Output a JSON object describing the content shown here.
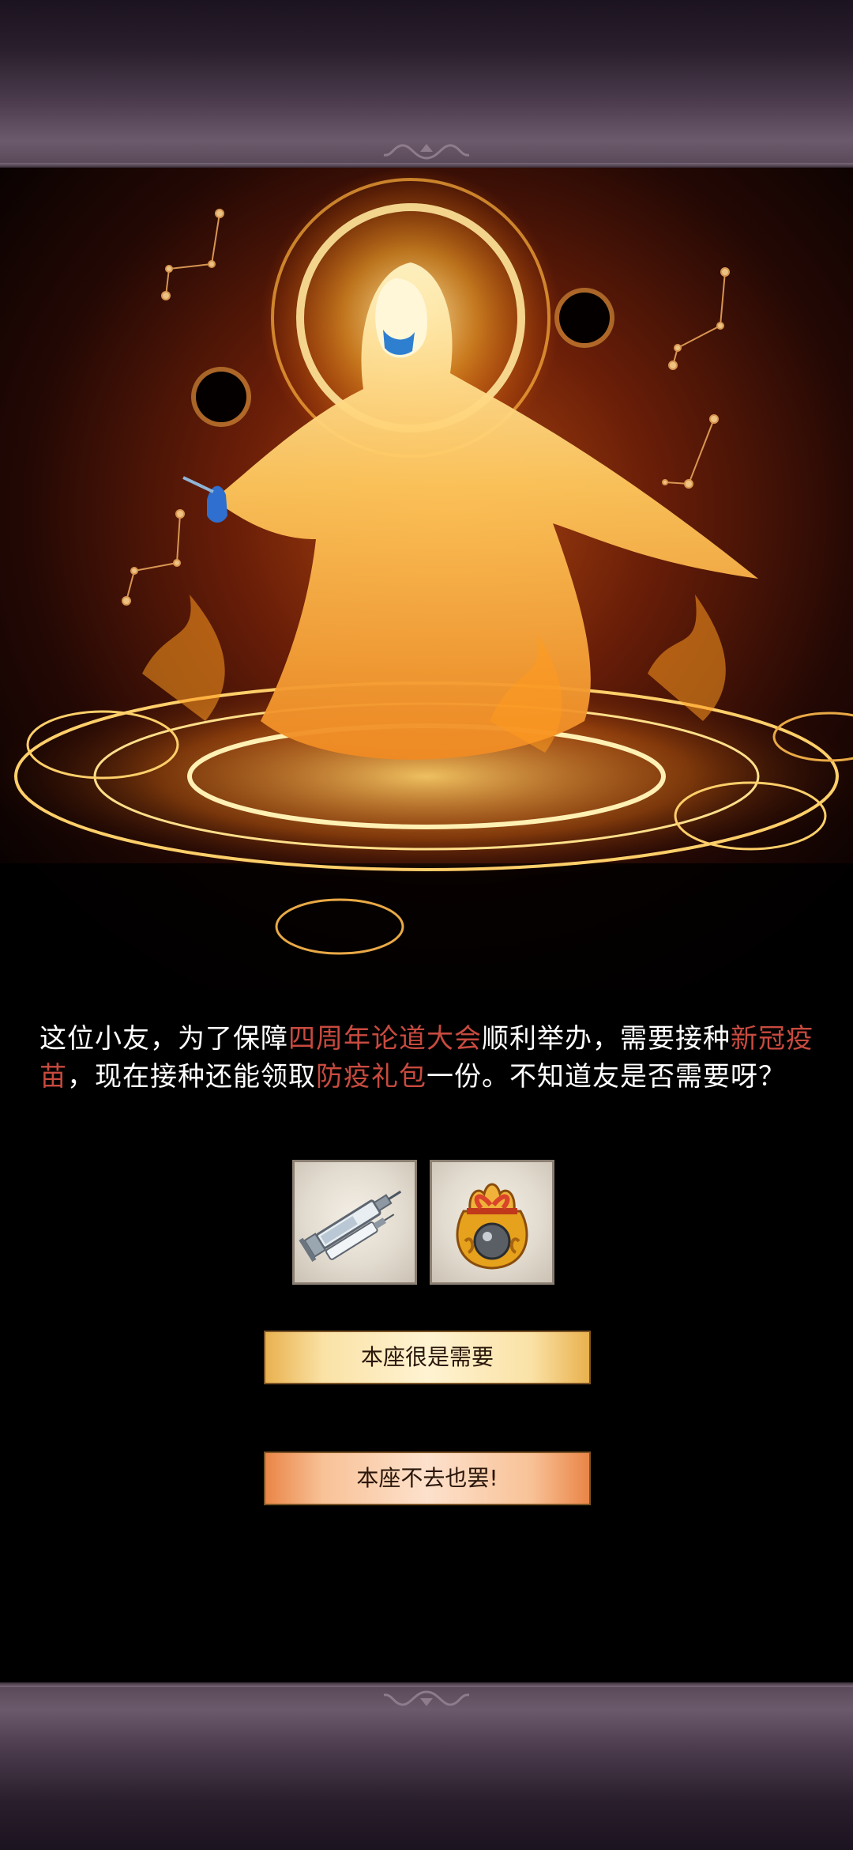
{
  "dialogue": {
    "segments": [
      {
        "text": "这位小友，为了保障",
        "highlight": false
      },
      {
        "text": "四周年论道大会",
        "highlight": true
      },
      {
        "text": "顺利举办，需要接种",
        "highlight": false
      },
      {
        "text": "新冠疫苗",
        "highlight": true
      },
      {
        "text": "，现在接种还能领取",
        "highlight": false
      },
      {
        "text": "防疫礼包",
        "highlight": true
      },
      {
        "text": "一份。不知道友是否需要呀？",
        "highlight": false
      }
    ]
  },
  "rewards": [
    {
      "icon": "syringe-icon"
    },
    {
      "icon": "gift-bag-icon"
    }
  ],
  "buttons": {
    "accept_label": "本座很是需要",
    "decline_label": "本座不去也罢!"
  },
  "colors": {
    "highlight_text": "#c84a3f",
    "accept_button": "#fae2a6",
    "decline_button": "#f8c297"
  }
}
